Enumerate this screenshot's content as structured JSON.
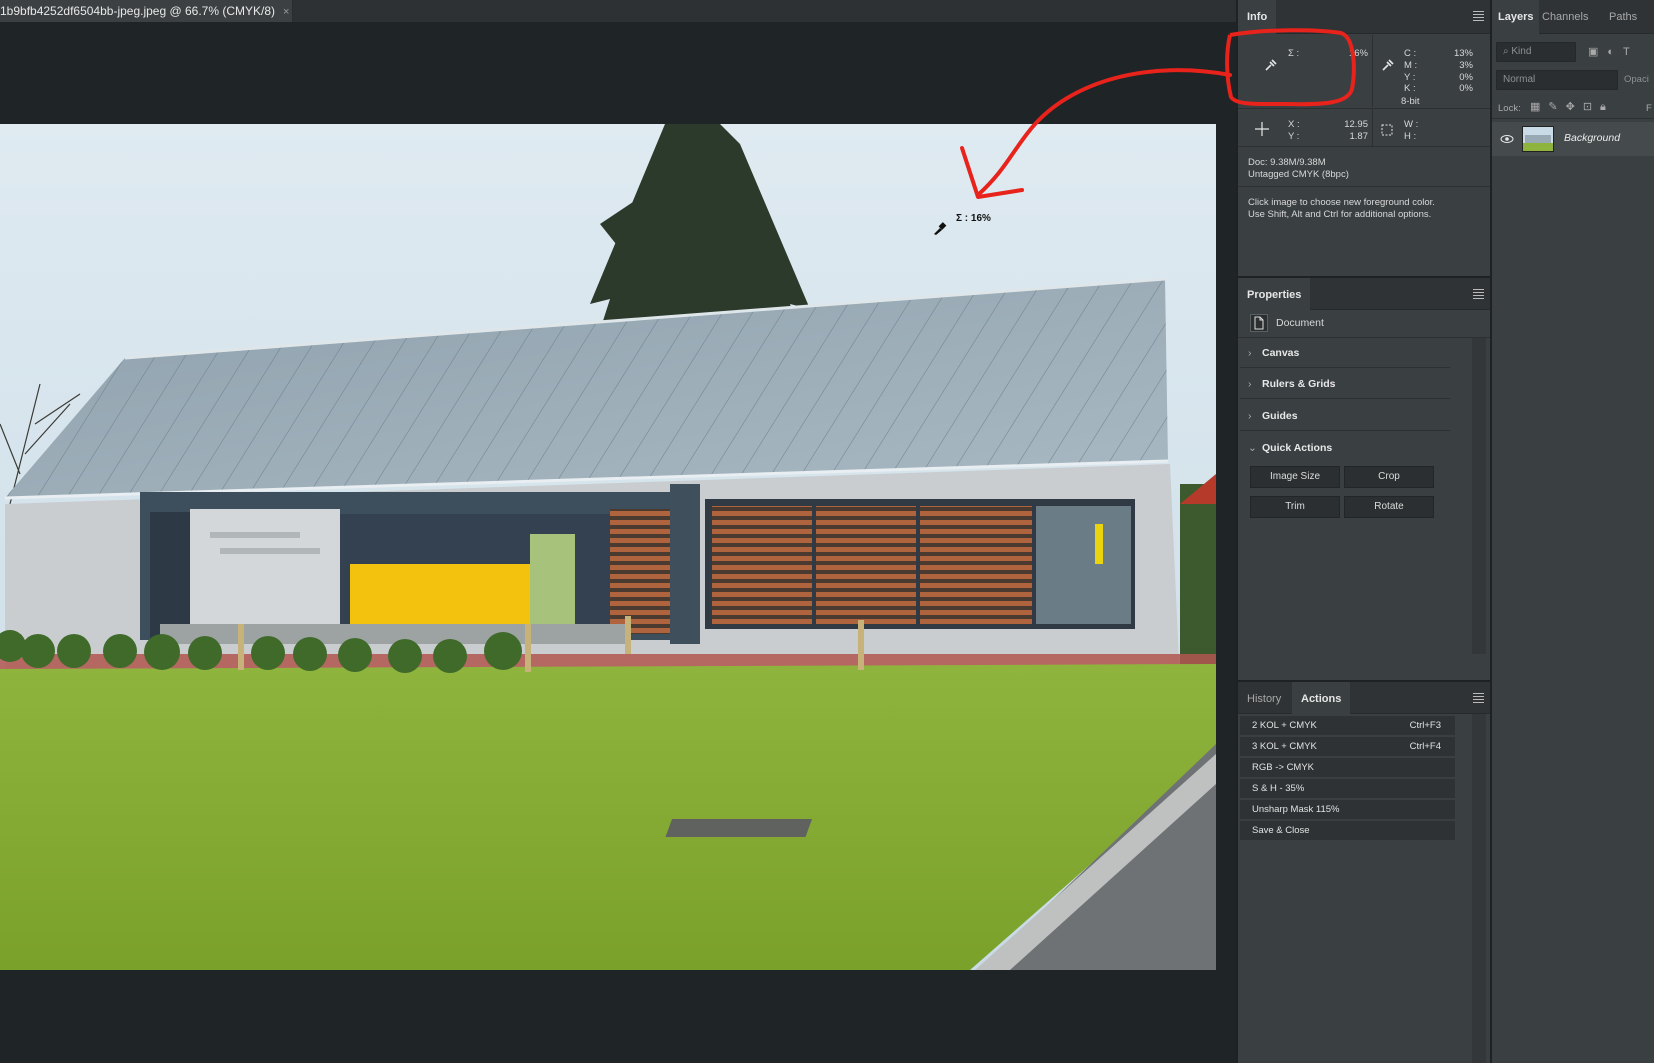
{
  "document": {
    "tab_title": "1b9bfb4252df6504bb-jpeg.jpeg @ 66.7% (CMYK/8)",
    "close_glyph": "×",
    "cursor_readout": "Σ : 16%"
  },
  "info_panel": {
    "tab": "Info",
    "sample_label": "Σ :",
    "sample_value": "16%",
    "cmyk": [
      {
        "label": "C :",
        "value": "13%"
      },
      {
        "label": "M :",
        "value": "3%"
      },
      {
        "label": "Y :",
        "value": "0%"
      },
      {
        "label": "K :",
        "value": "0%"
      }
    ],
    "bit_depth": "8-bit",
    "x_label": "X :",
    "x_value": "12.95",
    "y_label": "Y :",
    "y_value": "1.87",
    "w_label": "W :",
    "h_label": "H :",
    "doc_size": "Doc: 9.38M/9.38M",
    "profile": "Untagged CMYK (8bpc)",
    "hint_line1": "Click image to choose new foreground color.",
    "hint_line2": "Use Shift, Alt and Ctrl for additional options."
  },
  "properties_panel": {
    "tab": "Properties",
    "doc_label": "Document",
    "sections": [
      "Canvas",
      "Rulers & Grids",
      "Guides",
      "Quick Actions"
    ],
    "quick_actions": [
      "Image Size",
      "Crop",
      "Trim",
      "Rotate"
    ]
  },
  "history_actions_panel": {
    "tabs": [
      "History",
      "Actions"
    ],
    "actions": [
      {
        "name": "2 KOL + CMYK",
        "shortcut": "Ctrl+F3"
      },
      {
        "name": "3 KOL + CMYK",
        "shortcut": "Ctrl+F4"
      },
      {
        "name": "RGB -> CMYK",
        "shortcut": ""
      },
      {
        "name": "S & H - 35%",
        "shortcut": ""
      },
      {
        "name": "Unsharp Mask 115%",
        "shortcut": ""
      },
      {
        "name": "Save & Close",
        "shortcut": ""
      }
    ]
  },
  "layers_panel": {
    "tabs": [
      "Layers",
      "Channels",
      "Paths"
    ],
    "kind_placeholder": "Kind",
    "blend_mode": "Normal",
    "opacity_label": "Opaci",
    "lock_label": "Lock:",
    "lock_right": "F",
    "layer_name": "Background"
  },
  "colors": {
    "annotation_red": "#e8231c",
    "panel_bg": "#3a3f42",
    "header_bg": "#2f3336",
    "canvas_bg": "#1f2426"
  }
}
